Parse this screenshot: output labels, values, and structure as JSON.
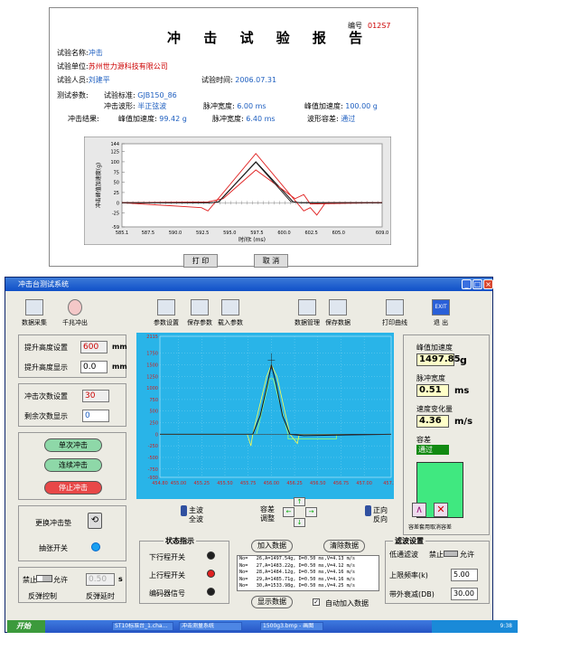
{
  "report": {
    "title": "冲 击 试 验 报 告",
    "no_label": "编号",
    "no_value": "012S7",
    "name_label": "试验名称:",
    "name_value": "冲击",
    "unit_label": "试验单位:",
    "unit_value": "苏州世力源科技有限公司",
    "person_label": "试验人员:",
    "person_value": "刘建平",
    "time_label": "试验时间:",
    "time_value": "2006.07.31",
    "params_label": "测试参数:",
    "std_label": "试验标准:",
    "std_value": "GJB150_86",
    "wave_label": "冲击波形:",
    "wave_value": "半正弦波",
    "width_label": "脉冲宽度:",
    "width_value": "6.00",
    "width_unit": "ms",
    "peak_label": "峰值加速度:",
    "peak_value": "100.00",
    "peak_unit": "g",
    "result_label": "冲击结果:",
    "rpeak_label": "峰值加速度:",
    "rpeak_value": "99.42",
    "rpeak_unit": "g",
    "rwidth_label": "脉冲宽度:",
    "rwidth_value": "6.40",
    "rwidth_unit": "ms",
    "tol_label": "波形容差:",
    "tol_value": "通过",
    "print_btn": "打 印",
    "cancel_btn": "取 消",
    "chart_data": {
      "type": "line",
      "ylabel": "冲击峰值加速度(g)",
      "xlabel": "时间t (ms)",
      "yticks": [
        "144",
        "125",
        "100",
        "75",
        "50",
        "25",
        "0",
        "-25",
        "-59"
      ],
      "xticks": [
        "585.1",
        "587.5",
        "590.0",
        "592.5",
        "595.0",
        "597.5",
        "600.0",
        "602.5",
        "605.0",
        "609.0"
      ],
      "xlim": [
        585.1,
        609.0
      ],
      "ylim": [
        -59,
        144
      ],
      "series": [
        {
          "x": [
            585.1,
            593.4,
            594.0,
            597.4,
            600.8,
            601.4,
            609.0
          ],
          "y": [
            0,
            0,
            3,
            100,
            3,
            0,
            0
          ]
        },
        {
          "x": [
            585.1,
            592.4,
            593.0,
            597.4,
            601.8,
            602.4,
            603.0,
            603.8,
            609.0
          ],
          "y": [
            0,
            -12,
            -20,
            120,
            -20,
            -12,
            -30,
            0,
            0
          ]
        },
        {
          "x": [
            585.1,
            593.0,
            594.4,
            597.4,
            601.0,
            601.8,
            602.4,
            609.0
          ],
          "y": [
            0,
            2,
            10,
            80,
            10,
            20,
            -3,
            0
          ]
        },
        {
          "x": [
            585.1,
            593.2,
            594.0,
            597.4,
            600.6,
            601.6,
            609.0
          ],
          "y": [
            0,
            0,
            2,
            99,
            3,
            0,
            0
          ]
        }
      ]
    }
  },
  "app": {
    "title": "冲击台测试系统",
    "toolbar": [
      {
        "label": "数据采集",
        "icon": "data-acquisition-icon"
      },
      {
        "label": "千兆冲出",
        "icon": "stop-icon"
      },
      {
        "label": "参数设置",
        "icon": "settings-icon"
      },
      {
        "label": "保存参数",
        "icon": "save-params-icon"
      },
      {
        "label": "载入参数",
        "icon": "load-params-icon"
      },
      {
        "label": "数据管理",
        "icon": "data-manage-icon"
      },
      {
        "label": "保存数据",
        "icon": "save-data-icon"
      },
      {
        "label": "打印曲线",
        "icon": "print-curve-icon"
      },
      {
        "label": "退 出",
        "icon": "exit-icon"
      }
    ],
    "exit_icon_text": "EXIT",
    "lift_set_label": "提升高度设置",
    "lift_set_value": "600",
    "lift_set_unit": "mm",
    "lift_disp_label": "提升高度显示",
    "lift_disp_value": "0.0",
    "lift_disp_unit": "mm",
    "count_set_label": "冲击次数设置",
    "count_set_value": "30",
    "count_rem_label": "剩余次数显示",
    "count_rem_value": "0",
    "single_btn": "单次冲击",
    "continuous_btn": "连续冲击",
    "stop_btn": "停止冲击",
    "change_pad_label": "更换冲击垫",
    "brake_label": "抽张开关",
    "forbid_label": "禁止",
    "allow_label": "允许",
    "delay_value": "0.50",
    "delay_unit": "s",
    "rebound_label": "反弹控制",
    "rebound_delay_label": "反弹延时",
    "plot": {
      "yticks": [
        "2115",
        "1750",
        "1500",
        "1250",
        "1000",
        "750",
        "500",
        "250",
        "0",
        "-250",
        "-500",
        "-750",
        "-930"
      ],
      "xticks": [
        "454.80",
        "455.00",
        "455.25",
        "455.50",
        "455.75",
        "456.00",
        "456.25",
        "456.50",
        "456.75",
        "457.00",
        "457.29"
      ]
    },
    "peak_label": "峰值加速度",
    "peak_value": "1497.85",
    "peak_unit": "g",
    "pulse_label": "脉冲宽度",
    "pulse_value": "0.51",
    "pulse_unit": "ms",
    "dv_label": "速度变化量",
    "dv_value": "4.36",
    "dv_unit": "m/s",
    "tol_label": "容差",
    "tol_value": "通过",
    "main_wave": "主波",
    "full_wave": "全波",
    "tol_adjust": "容差\n调整",
    "forward": "正向",
    "reverse": "反向",
    "tol_apply": "容差套用",
    "tol_cancel": "取消容差",
    "status_title": "状态指示",
    "status_items": [
      {
        "label": "下行程开关",
        "color": "#202020"
      },
      {
        "label": "上行程开关",
        "color": "#e02020"
      },
      {
        "label": "编码器信号",
        "color": "#202020"
      }
    ],
    "add_data_btn": "加入数据",
    "clear_data_btn": "清除数据",
    "show_data_btn": "显示数据",
    "auto_add_label": "自动加入数据",
    "data_rows": [
      "No=   26,A=1497.54g, D=0.50 ms,V=4.13 m/s",
      "No=   27,A=1483.22g, D=0.50 ms,V=4.12 m/s",
      "No=   28,A=1484.12g, D=0.50 ms,V=4.16 m/s",
      "No=   29,A=1485.71g, D=0.50 ms,V=4.16 m/s",
      "No=   30,A=1533.98g, D=0.50 ms,V=4.25 m/s"
    ],
    "filter_title": "滤波设置",
    "lowpass_label": "低通滤波",
    "lp_forbid": "禁止",
    "lp_allow": "允许",
    "cutoff_label": "上限频率(k)",
    "cutoff_value": "5.00",
    "atten_label": "带外衰减(DB)",
    "atten_value": "30.00"
  },
  "taskbar": {
    "start": "开始",
    "tasks": [
      "ST10标准台_1.cha...",
      "冲击测量系统",
      "1500g3.bmp - 画图"
    ],
    "clock": "9:38"
  }
}
